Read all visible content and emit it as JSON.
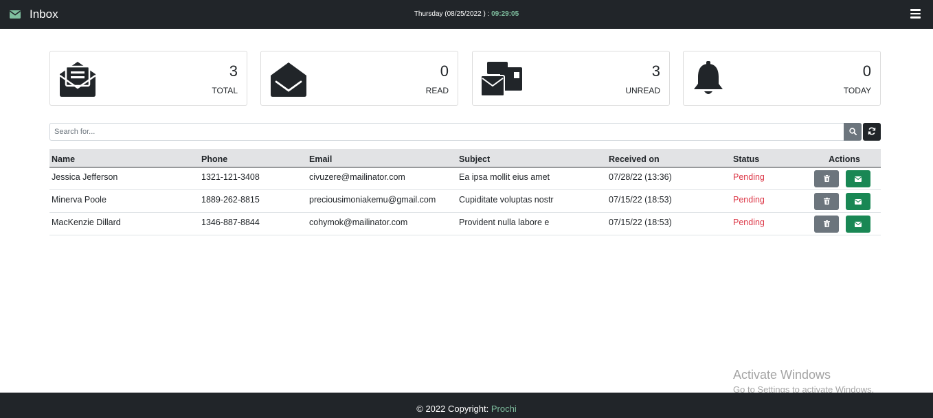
{
  "navbar": {
    "icon": "envelope-icon",
    "title": "Inbox",
    "clock_prefix": "Thursday (08/25/2022 ) : ",
    "clock_time": "09:29:05",
    "menu_icon": "hamburger-menu-icon"
  },
  "stats": [
    {
      "icon": "envelope-open-text-icon",
      "value": "3",
      "label": "TOTAL"
    },
    {
      "icon": "envelope-open-icon",
      "value": "0",
      "label": "READ"
    },
    {
      "icon": "mail-bulk-icon",
      "value": "3",
      "label": "UNREAD"
    },
    {
      "icon": "bell-icon",
      "value": "0",
      "label": "TODAY"
    }
  ],
  "search": {
    "placeholder": "Search for...",
    "value": "",
    "search_icon": "search-icon",
    "refresh_icon": "refresh-icon"
  },
  "table": {
    "headers": [
      "Name",
      "Phone",
      "Email",
      "Subject",
      "Received on",
      "Status",
      "Actions"
    ],
    "rows": [
      {
        "name": "Jessica Jefferson",
        "phone": "1321-121-3408",
        "email": "civuzere@mailinator.com",
        "subject": "Ea ipsa mollit eius amet",
        "received": "07/28/22 (13:36)",
        "status": "Pending"
      },
      {
        "name": "Minerva Poole",
        "phone": "1889-262-8815",
        "email": "preciousimoniakemu@gmail.com",
        "subject": "Cupiditate voluptas nostr",
        "received": "07/15/22 (18:53)",
        "status": "Pending"
      },
      {
        "name": "MacKenzie Dillard",
        "phone": "1346-887-8844",
        "email": "cohymok@mailinator.com",
        "subject": "Provident nulla labore e",
        "received": "07/15/22 (18:53)",
        "status": "Pending"
      }
    ],
    "delete_icon": "trash-icon",
    "reply_icon": "envelope-icon"
  },
  "watermark": {
    "title": "Activate Windows",
    "subtitle": "Go to Settings to activate Windows."
  },
  "footer": {
    "text": "© 2022 Copyright: ",
    "link": "Prochi"
  },
  "colors": {
    "navbar_bg": "#212529",
    "accent_green": "#198754",
    "status_pending": "#dc3545",
    "clock_time": "#7fbf9f"
  }
}
